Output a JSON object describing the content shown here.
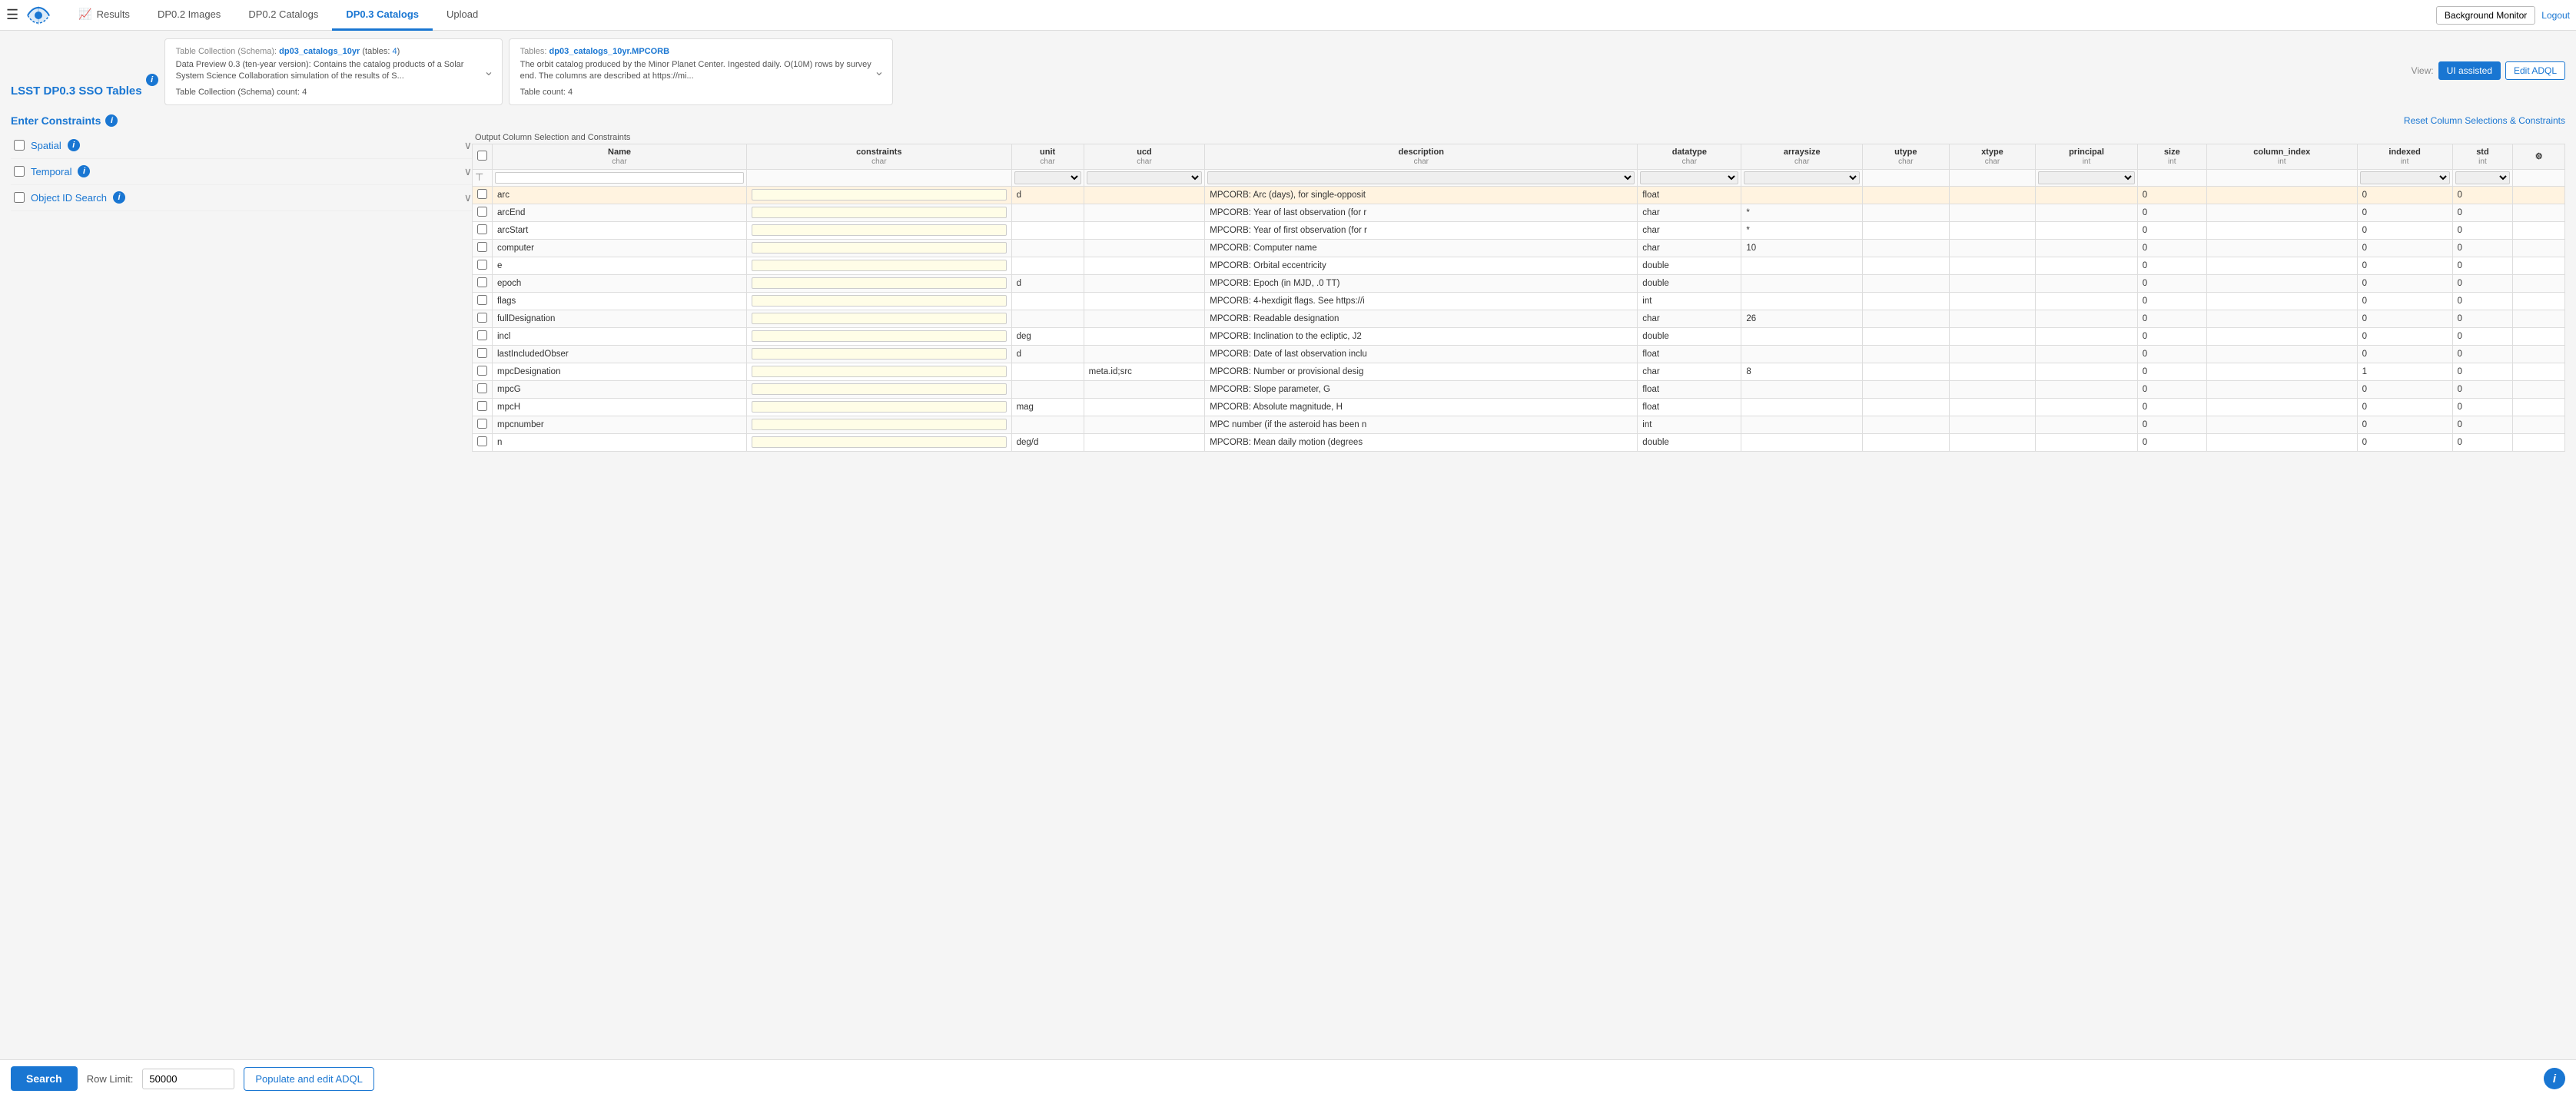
{
  "nav": {
    "tabs": [
      {
        "label": "Results",
        "icon": "📈",
        "active": false
      },
      {
        "label": "DP0.2 Images",
        "icon": "",
        "active": false
      },
      {
        "label": "DP0.2 Catalogs",
        "icon": "",
        "active": false
      },
      {
        "label": "DP0.3 Catalogs",
        "icon": "",
        "active": true
      },
      {
        "label": "Upload",
        "icon": "",
        "active": false
      }
    ],
    "bg_monitor": "Background Monitor",
    "logout": "Logout"
  },
  "sidebar": {
    "title": "LSST DP0.3 SSO Tables"
  },
  "collection": {
    "label": "Table Collection (Schema):",
    "name": "dp03_catalogs_10yr",
    "tables_label": "tables:",
    "tables_count": "4",
    "desc": "Data Preview 0.3 (ten-year version): Contains the catalog products of a Solar System Science Collaboration simulation of the results of S...",
    "count_label": "Table Collection (Schema) count: 4"
  },
  "tables": {
    "label": "Tables:",
    "name": "dp03_catalogs_10yr.MPCORB",
    "desc": "The orbit catalog produced by the Minor Planet Center. Ingested daily. O(10M) rows by survey end. The columns are described at https://mi...",
    "count_label": "Table count: 4"
  },
  "view": {
    "label": "View:",
    "ui_label": "UI assisted",
    "adql_label": "Edit ADQL"
  },
  "constraints": {
    "title": "Enter Constraints",
    "reset_label": "Reset Column Selections & Constraints",
    "output_label": "Output Column Selection and Constraints",
    "spatial": {
      "label": "Spatial"
    },
    "temporal": {
      "label": "Temporal"
    },
    "object_id": {
      "label": "Object ID Search"
    }
  },
  "table_headers": {
    "name": "Name",
    "name_sub": "char",
    "constraints": "constraints",
    "constraints_sub": "char",
    "unit": "unit",
    "unit_sub": "char",
    "ucd": "ucd",
    "ucd_sub": "char",
    "description": "description",
    "description_sub": "char",
    "datatype": "datatype",
    "datatype_sub": "char",
    "arraysize": "arraysize",
    "arraysize_sub": "char",
    "utype": "utype",
    "utype_sub": "char",
    "xtype": "xtype",
    "xtype_sub": "char",
    "principal": "principal",
    "principal_sub": "int",
    "size": "size",
    "size_sub": "int",
    "column_index": "column_index",
    "column_index_sub": "int",
    "indexed": "indexed",
    "indexed_sub": "int",
    "std": "std",
    "std_sub": "int"
  },
  "rows": [
    {
      "name": "arc",
      "constraints": "",
      "unit": "d",
      "ucd": "",
      "description": "MPCORB: Arc (days), for single-opposit",
      "datatype": "float",
      "arraysize": "",
      "utype": "",
      "xtype": "",
      "principal": "",
      "size": "0",
      "column_index": "",
      "indexed": "0",
      "std": "0",
      "highlighted": true
    },
    {
      "name": "arcEnd",
      "constraints": "",
      "unit": "",
      "ucd": "",
      "description": "MPCORB: Year of last observation (for r",
      "datatype": "char",
      "arraysize": "*",
      "utype": "",
      "xtype": "",
      "principal": "",
      "size": "0",
      "column_index": "",
      "indexed": "0",
      "std": "0",
      "highlighted": false
    },
    {
      "name": "arcStart",
      "constraints": "",
      "unit": "",
      "ucd": "",
      "description": "MPCORB: Year of first observation (for r",
      "datatype": "char",
      "arraysize": "*",
      "utype": "",
      "xtype": "",
      "principal": "",
      "size": "0",
      "column_index": "",
      "indexed": "0",
      "std": "0",
      "highlighted": false
    },
    {
      "name": "computer",
      "constraints": "",
      "unit": "",
      "ucd": "",
      "description": "MPCORB: Computer name",
      "datatype": "char",
      "arraysize": "10",
      "utype": "",
      "xtype": "",
      "principal": "",
      "size": "0",
      "column_index": "",
      "indexed": "0",
      "std": "0",
      "highlighted": false
    },
    {
      "name": "e",
      "constraints": "",
      "unit": "",
      "ucd": "",
      "description": "MPCORB: Orbital eccentricity",
      "datatype": "double",
      "arraysize": "",
      "utype": "",
      "xtype": "",
      "principal": "",
      "size": "0",
      "column_index": "",
      "indexed": "0",
      "std": "0",
      "highlighted": false
    },
    {
      "name": "epoch",
      "constraints": "",
      "unit": "d",
      "ucd": "",
      "description": "MPCORB: Epoch (in MJD, .0 TT)",
      "datatype": "double",
      "arraysize": "",
      "utype": "",
      "xtype": "",
      "principal": "",
      "size": "0",
      "column_index": "",
      "indexed": "0",
      "std": "0",
      "highlighted": false
    },
    {
      "name": "flags",
      "constraints": "",
      "unit": "",
      "ucd": "",
      "description": "MPCORB: 4-hexdigit flags. See https://i",
      "datatype": "int",
      "arraysize": "",
      "utype": "",
      "xtype": "",
      "principal": "",
      "size": "0",
      "column_index": "",
      "indexed": "0",
      "std": "0",
      "highlighted": false
    },
    {
      "name": "fullDesignation",
      "constraints": "",
      "unit": "",
      "ucd": "",
      "description": "MPCORB: Readable designation",
      "datatype": "char",
      "arraysize": "26",
      "utype": "",
      "xtype": "",
      "principal": "",
      "size": "0",
      "column_index": "",
      "indexed": "0",
      "std": "0",
      "highlighted": false
    },
    {
      "name": "incl",
      "constraints": "",
      "unit": "deg",
      "ucd": "",
      "description": "MPCORB: Inclination to the ecliptic, J2",
      "datatype": "double",
      "arraysize": "",
      "utype": "",
      "xtype": "",
      "principal": "",
      "size": "0",
      "column_index": "",
      "indexed": "0",
      "std": "0",
      "highlighted": false
    },
    {
      "name": "lastIncludedObser",
      "constraints": "",
      "unit": "d",
      "ucd": "",
      "description": "MPCORB: Date of last observation inclu",
      "datatype": "float",
      "arraysize": "",
      "utype": "",
      "xtype": "",
      "principal": "",
      "size": "0",
      "column_index": "",
      "indexed": "0",
      "std": "0",
      "highlighted": false
    },
    {
      "name": "mpcDesignation",
      "constraints": "",
      "unit": "",
      "ucd": "meta.id;src",
      "description": "MPCORB: Number or provisional desig",
      "datatype": "char",
      "arraysize": "8",
      "utype": "",
      "xtype": "",
      "principal": "",
      "size": "0",
      "column_index": "",
      "indexed": "1",
      "std": "0",
      "highlighted": false
    },
    {
      "name": "mpcG",
      "constraints": "",
      "unit": "",
      "ucd": "",
      "description": "MPCORB: Slope parameter, G",
      "datatype": "float",
      "arraysize": "",
      "utype": "",
      "xtype": "",
      "principal": "",
      "size": "0",
      "column_index": "",
      "indexed": "0",
      "std": "0",
      "highlighted": false
    },
    {
      "name": "mpcH",
      "constraints": "",
      "unit": "mag",
      "ucd": "",
      "description": "MPCORB: Absolute magnitude, H",
      "datatype": "float",
      "arraysize": "",
      "utype": "",
      "xtype": "",
      "principal": "",
      "size": "0",
      "column_index": "",
      "indexed": "0",
      "std": "0",
      "highlighted": false
    },
    {
      "name": "mpcnumber",
      "constraints": "",
      "unit": "",
      "ucd": "",
      "description": "MPC number (if the asteroid has been n",
      "datatype": "int",
      "arraysize": "",
      "utype": "",
      "xtype": "",
      "principal": "",
      "size": "0",
      "column_index": "",
      "indexed": "0",
      "std": "0",
      "highlighted": false
    },
    {
      "name": "n",
      "constraints": "",
      "unit": "deg/d",
      "ucd": "",
      "description": "MPCORB: Mean daily motion (degrees",
      "datatype": "double",
      "arraysize": "",
      "utype": "",
      "xtype": "",
      "principal": "",
      "size": "0",
      "column_index": "",
      "indexed": "0",
      "std": "0",
      "highlighted": false
    }
  ],
  "bottom": {
    "search_label": "Search",
    "row_limit_label": "Row Limit:",
    "row_limit_value": "50000",
    "populate_label": "Populate and edit ADQL"
  }
}
